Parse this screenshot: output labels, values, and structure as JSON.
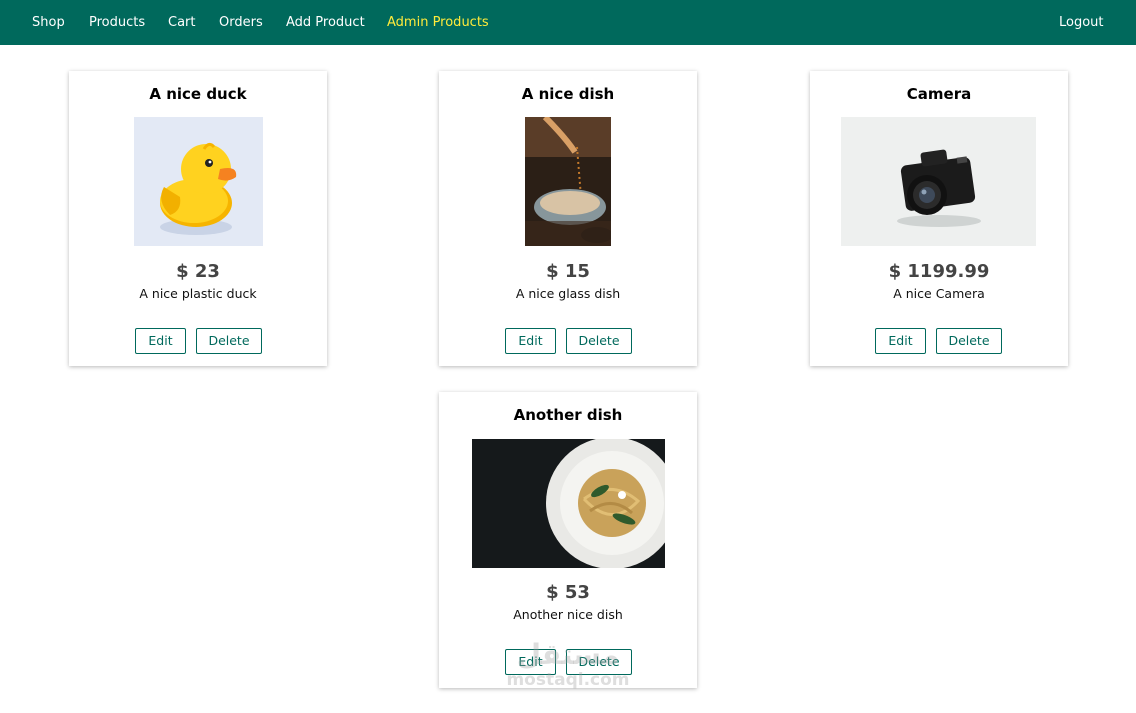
{
  "nav": {
    "items": [
      {
        "label": "Shop"
      },
      {
        "label": "Products"
      },
      {
        "label": "Cart"
      },
      {
        "label": "Orders"
      },
      {
        "label": "Add Product"
      },
      {
        "label": "Admin Products",
        "active": true
      }
    ],
    "logout": "Logout"
  },
  "products": [
    {
      "title": "A nice duck",
      "price": "$ 23",
      "description": "A nice plastic duck",
      "edit": "Edit",
      "delete": "Delete"
    },
    {
      "title": "A nice dish",
      "price": "$ 15",
      "description": "A nice glass dish",
      "edit": "Edit",
      "delete": "Delete"
    },
    {
      "title": "Camera",
      "price": "$ 1199.99",
      "description": "A nice Camera",
      "edit": "Edit",
      "delete": "Delete"
    },
    {
      "title": "Another dish",
      "price": "$ 53",
      "description": "Another nice dish",
      "edit": "Edit",
      "delete": "Delete"
    }
  ],
  "watermark": {
    "arabic": "مستقل",
    "latin": "mostaql.com"
  },
  "colors": {
    "nav_bg": "#00695c",
    "active_link": "#ffeb3b",
    "button_border": "#00695c"
  }
}
